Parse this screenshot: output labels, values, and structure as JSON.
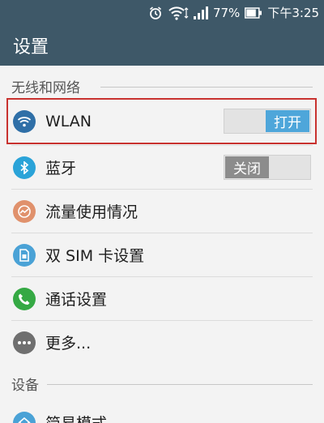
{
  "status_bar": {
    "battery_percent": "77%",
    "time": "下午3:25",
    "icons": [
      "alarm-icon",
      "wifi-icon",
      "signal-icon",
      "battery-icon"
    ]
  },
  "app_bar": {
    "title": "设置"
  },
  "sections": [
    {
      "header": "无线和网络"
    },
    {
      "header": "设备"
    }
  ],
  "items": [
    {
      "label": "WLAN",
      "icon": "wifi-icon",
      "icon_color": "#2f6fa7",
      "toggle": "打开",
      "toggle_state": "on"
    },
    {
      "label": "蓝牙",
      "icon": "bluetooth-icon",
      "icon_color": "#2aa3d8",
      "toggle": "关闭",
      "toggle_state": "off"
    },
    {
      "label": "流量使用情况",
      "icon": "data-usage-icon",
      "icon_color": "#e0916c"
    },
    {
      "label": "双 SIM 卡设置",
      "icon": "sim-card-icon",
      "icon_color": "#4aa2d6"
    },
    {
      "label": "通话设置",
      "icon": "phone-icon",
      "icon_color": "#35a944"
    },
    {
      "label": "更多...",
      "icon": "more-icon",
      "icon_color": "#6f6f6f"
    },
    {
      "label": "简易模式",
      "icon": "easy-mode-icon",
      "icon_color": "#4aa2d6"
    }
  ],
  "colors": {
    "header_bg": "#3e5868",
    "toggle_on": "#4ea6da",
    "toggle_off": "#8c8c8c",
    "highlight": "#c8322f"
  }
}
